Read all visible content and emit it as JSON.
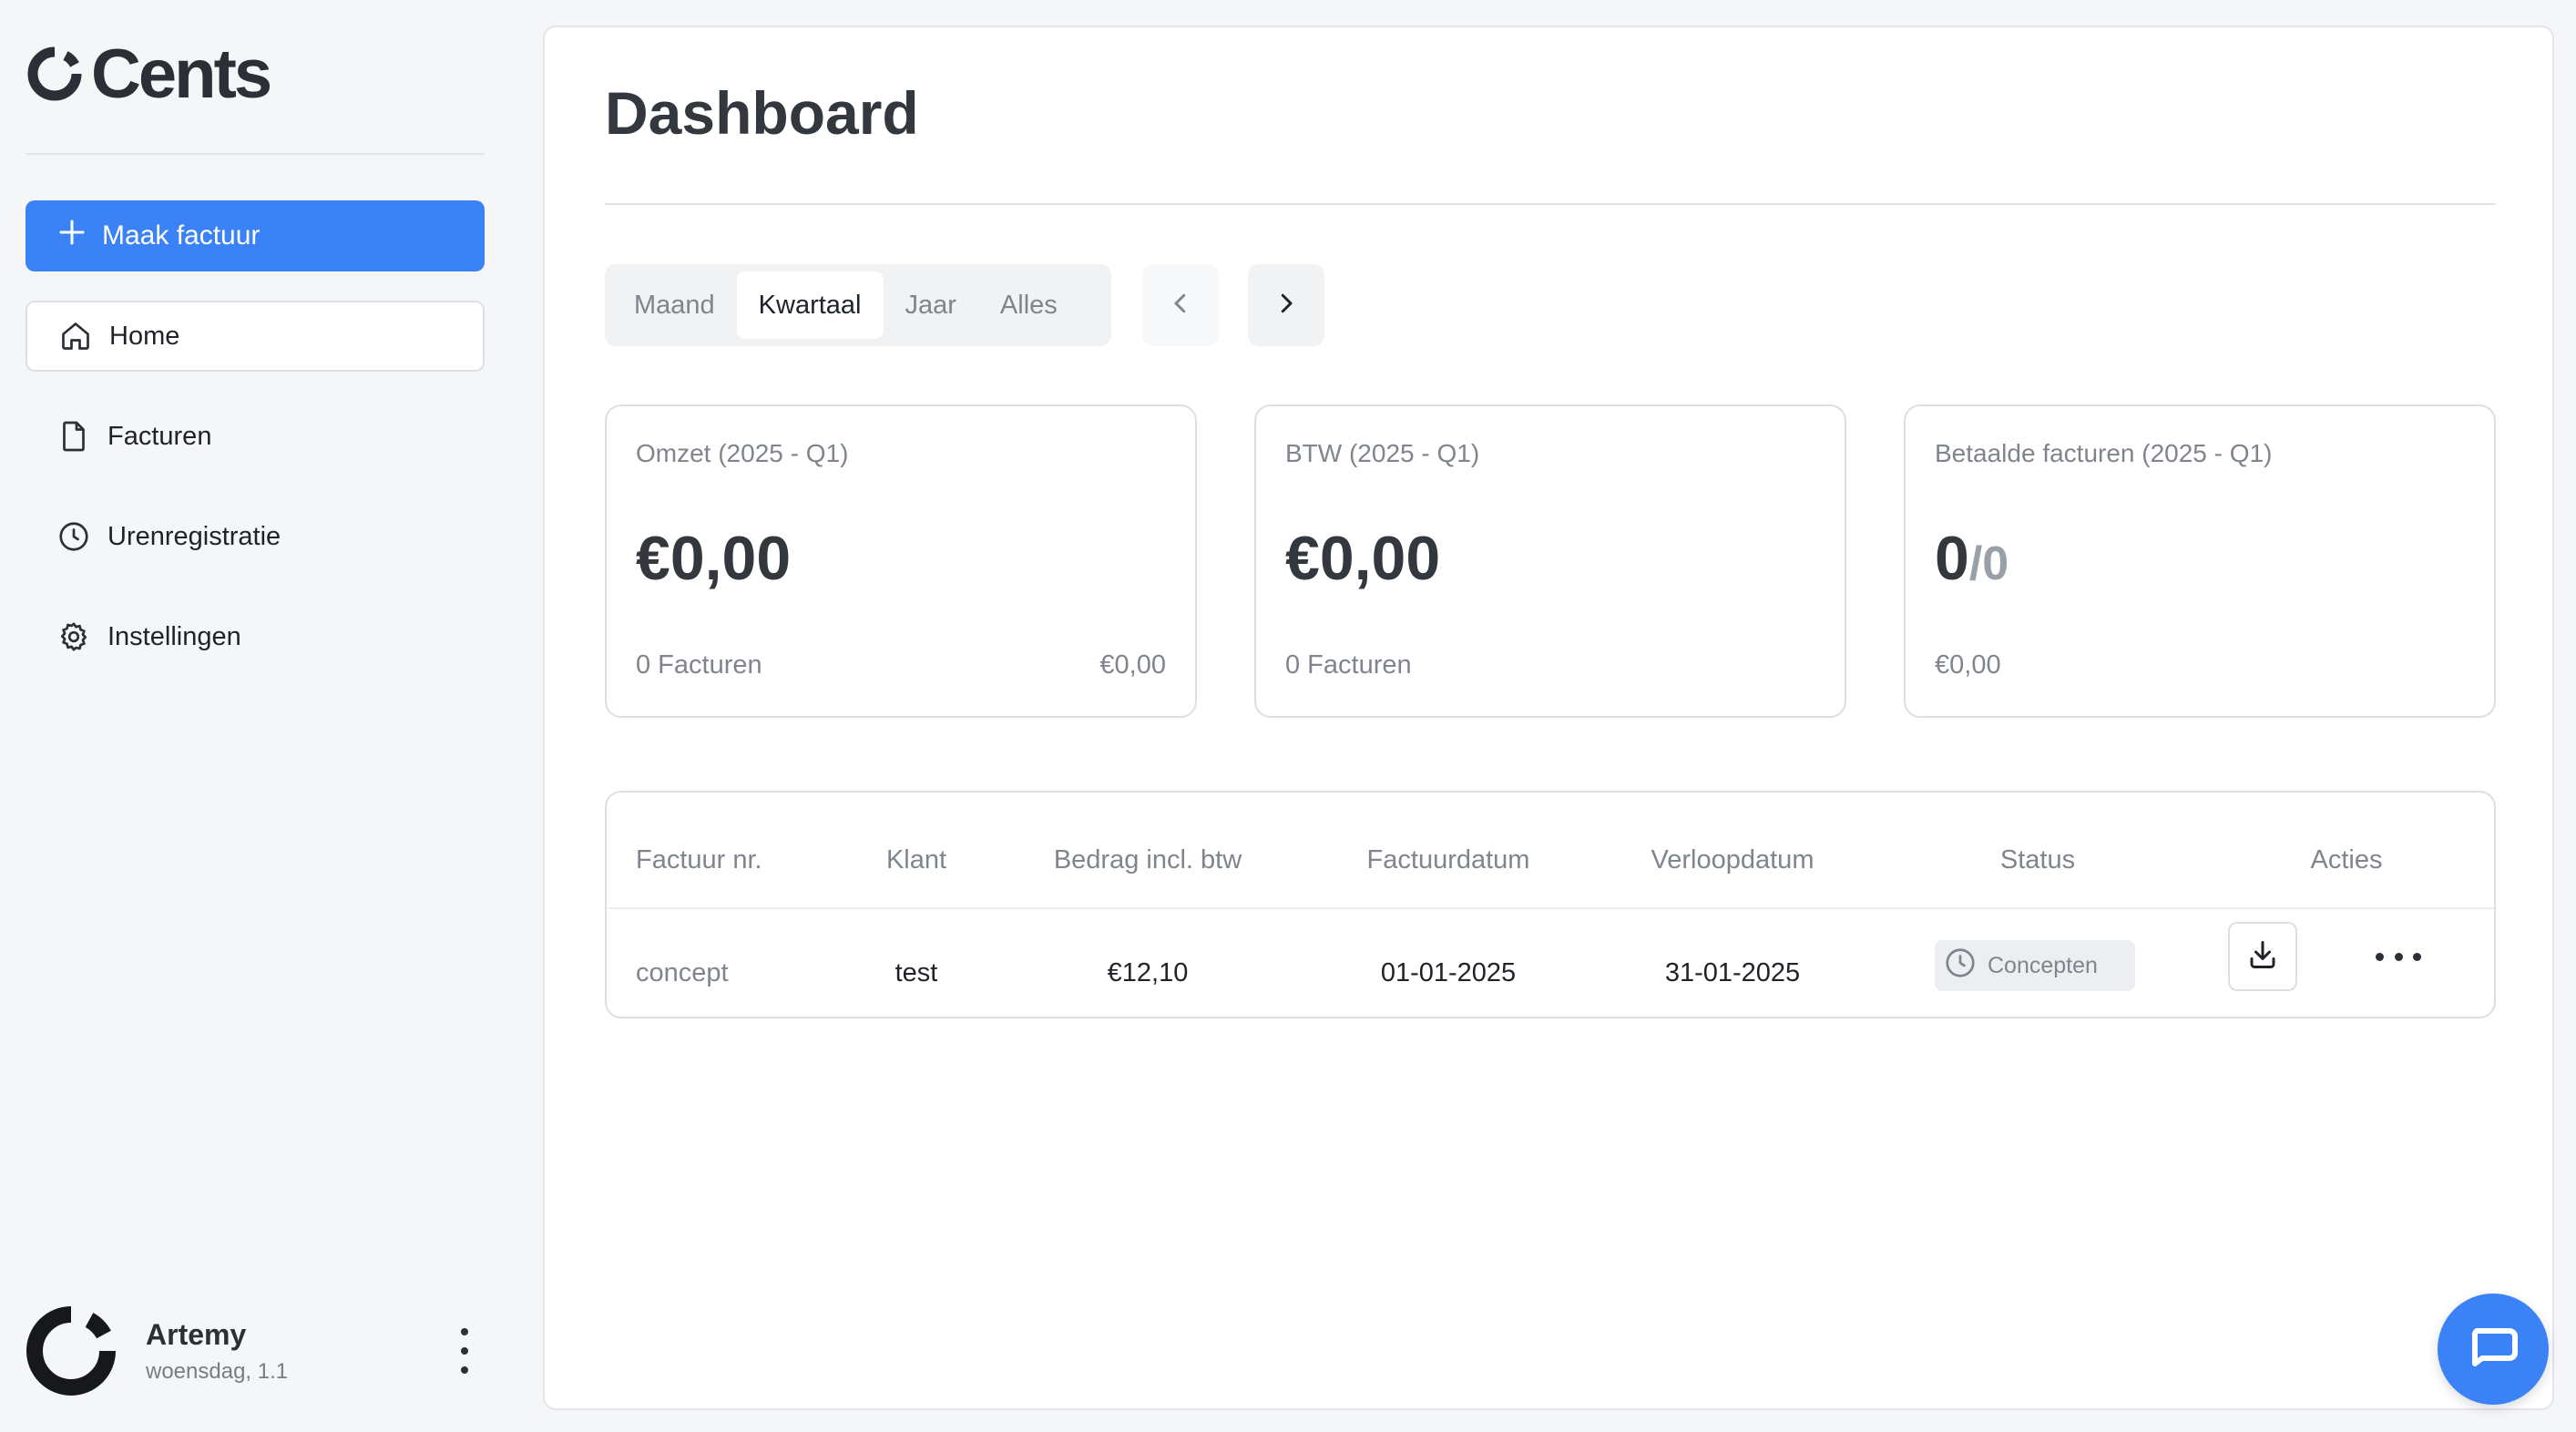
{
  "app": {
    "name": "Cents"
  },
  "sidebar": {
    "create_label": "Maak factuur",
    "items": [
      {
        "label": "Home",
        "icon": "home-icon",
        "active": true
      },
      {
        "label": "Facturen",
        "icon": "document-icon",
        "active": false
      },
      {
        "label": "Urenregistratie",
        "icon": "clock-icon",
        "active": false
      },
      {
        "label": "Instellingen",
        "icon": "gear-icon",
        "active": false
      }
    ],
    "user": {
      "name": "Artemy",
      "date": "woensdag, 1.1"
    }
  },
  "main": {
    "title": "Dashboard",
    "periods": [
      "Maand",
      "Kwartaal",
      "Jaar",
      "Alles"
    ],
    "active_period": "Kwartaal",
    "cards": [
      {
        "label": "Omzet (2025 - Q1)",
        "value": "€0,00",
        "foot_left": "0 Facturen",
        "foot_right": "€0,00"
      },
      {
        "label": "BTW (2025 - Q1)",
        "value": "€0,00",
        "foot_left": "0 Facturen"
      },
      {
        "label": "Betaalde facturen (2025 - Q1)",
        "value_main": "0",
        "value_sub": "/0",
        "foot_left": "€0,00"
      }
    ],
    "table": {
      "headers": [
        "Factuur nr.",
        "Klant",
        "Bedrag incl. btw",
        "Factuurdatum",
        "Verloopdatum",
        "Status",
        "Acties"
      ],
      "rows": [
        {
          "number": "concept",
          "client": "test",
          "amount": "€12,10",
          "invoice_date": "01-01-2025",
          "due_date": "31-01-2025",
          "status": "Concepten"
        }
      ]
    }
  },
  "colors": {
    "accent": "#3b82f6",
    "text": "#1f2328",
    "muted": "#80858d"
  }
}
